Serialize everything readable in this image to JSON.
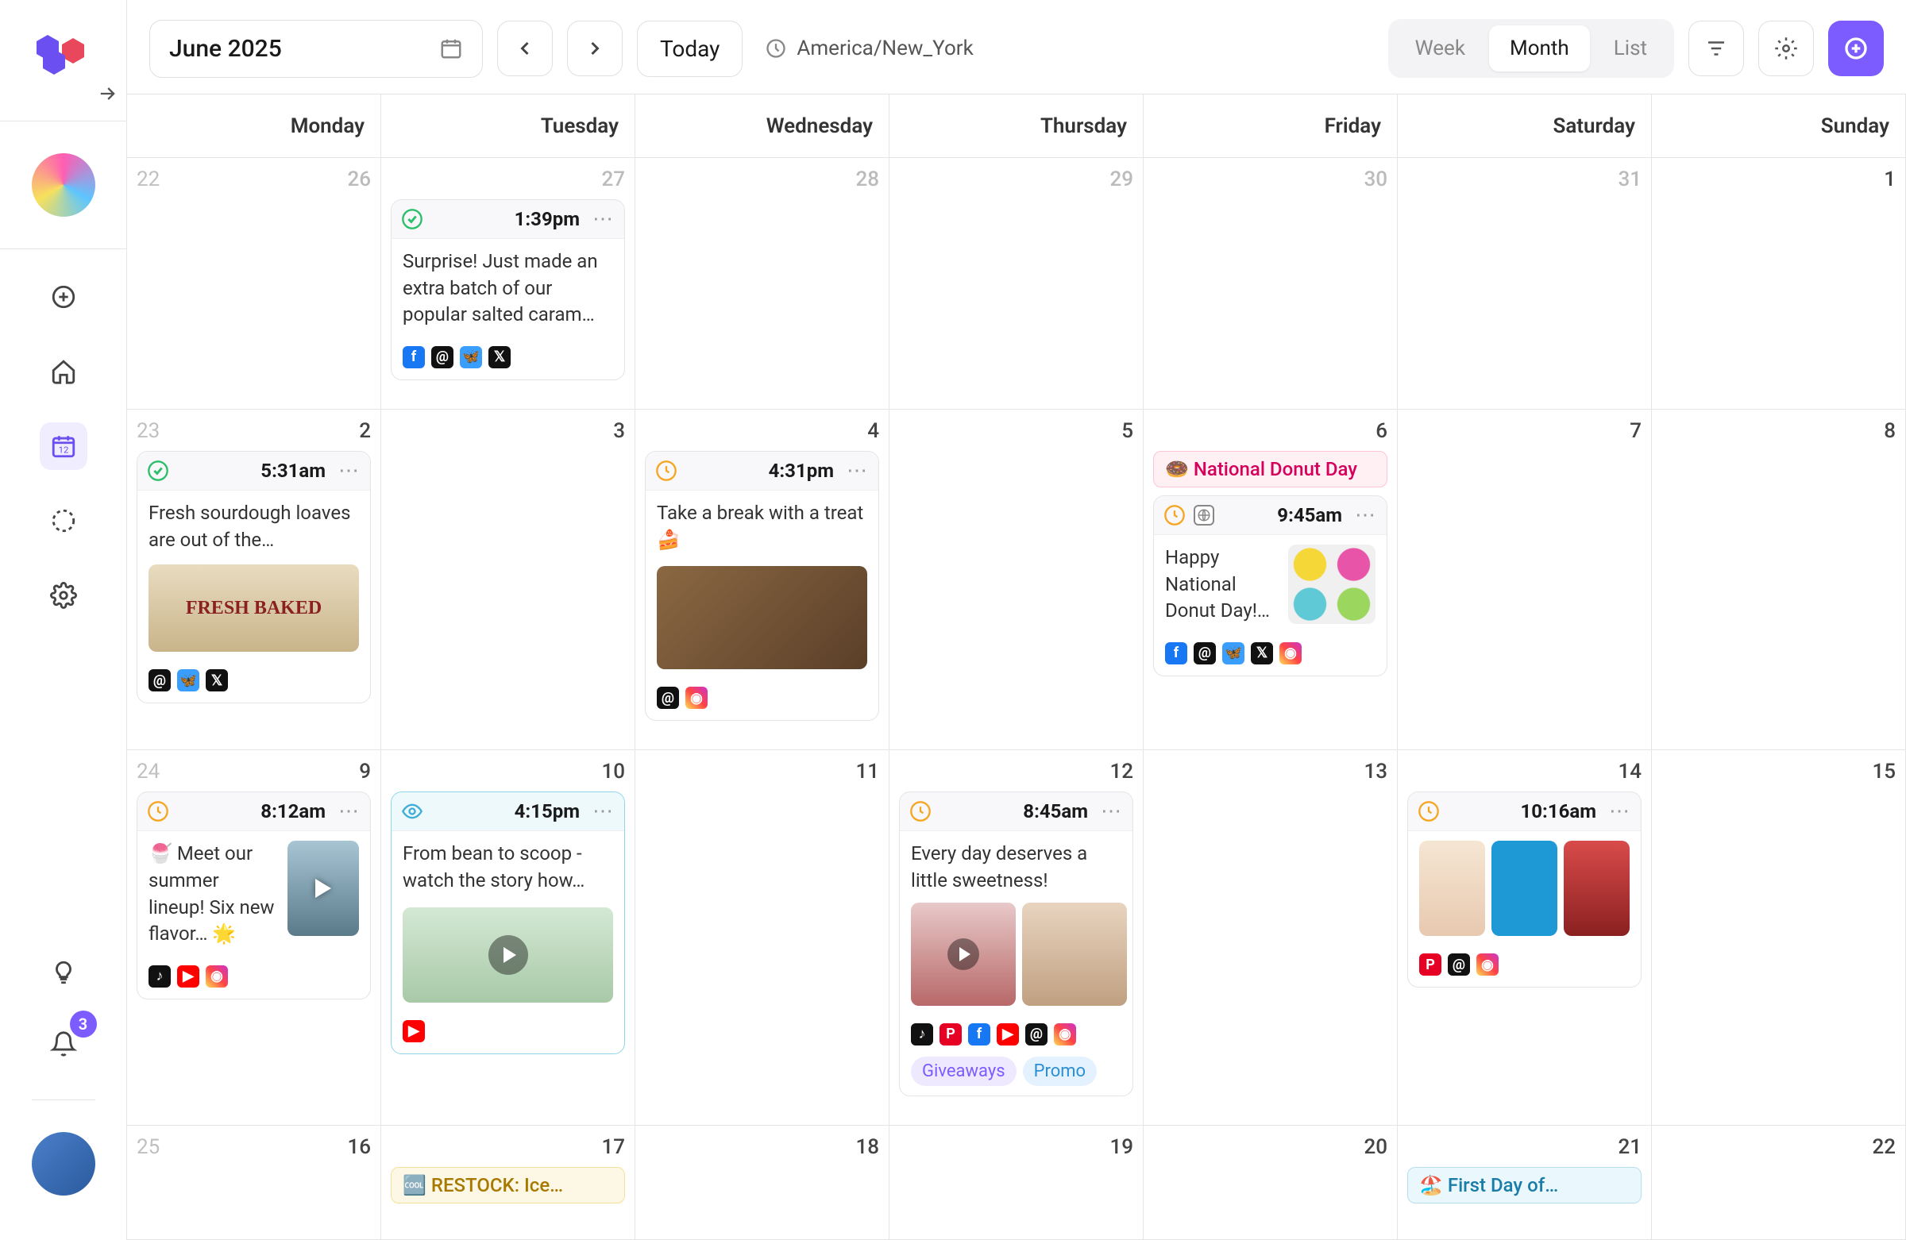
{
  "header": {
    "date_label": "June 2025",
    "today_label": "Today",
    "timezone": "America/New_York",
    "views": {
      "week": "Week",
      "month": "Month",
      "list": "List"
    }
  },
  "sidebar": {
    "notifications_count": "3"
  },
  "days": [
    "Monday",
    "Tuesday",
    "Wednesday",
    "Thursday",
    "Friday",
    "Saturday",
    "Sunday"
  ],
  "weeks": {
    "w22": {
      "num": "22",
      "d": [
        "26",
        "27",
        "28",
        "29",
        "30",
        "31",
        "1"
      ]
    },
    "w23": {
      "num": "23",
      "d": [
        "2",
        "3",
        "4",
        "5",
        "6",
        "7",
        "8"
      ]
    },
    "w24": {
      "num": "24",
      "d": [
        "9",
        "10",
        "11",
        "12",
        "13",
        "14",
        "15"
      ]
    },
    "w25": {
      "num": "25",
      "d": [
        "16",
        "17",
        "18",
        "19",
        "20",
        "21",
        "22"
      ]
    }
  },
  "holidays": {
    "donut": "🍩 National Donut Day",
    "restock": "🆒 RESTOCK: Ice…",
    "summer": "🏖️ First Day of…"
  },
  "posts": {
    "p27": {
      "time": "1:39pm",
      "text": "Surprise! Just made an extra batch of our popular salted caram…"
    },
    "p2": {
      "time": "5:31am",
      "text": "Fresh sourdough loaves are out of the…",
      "thumb_label": "FRESH BAKED"
    },
    "p4": {
      "time": "4:31pm",
      "text": "Take a break with a treat 🍰"
    },
    "p6": {
      "time": "9:45am",
      "text": "Happy National Donut Day!…"
    },
    "p9": {
      "time": "8:12am",
      "text": "🍧 Meet our summer lineup! Six new flavor… 🌟"
    },
    "p10": {
      "time": "4:15pm",
      "text": "From bean to scoop - watch the story how…"
    },
    "p12": {
      "time": "8:45am",
      "text": "Every day deserves a little sweetness!",
      "chip1": "Giveaways",
      "chip2": "Promo"
    },
    "p14": {
      "time": "10:16am"
    }
  }
}
